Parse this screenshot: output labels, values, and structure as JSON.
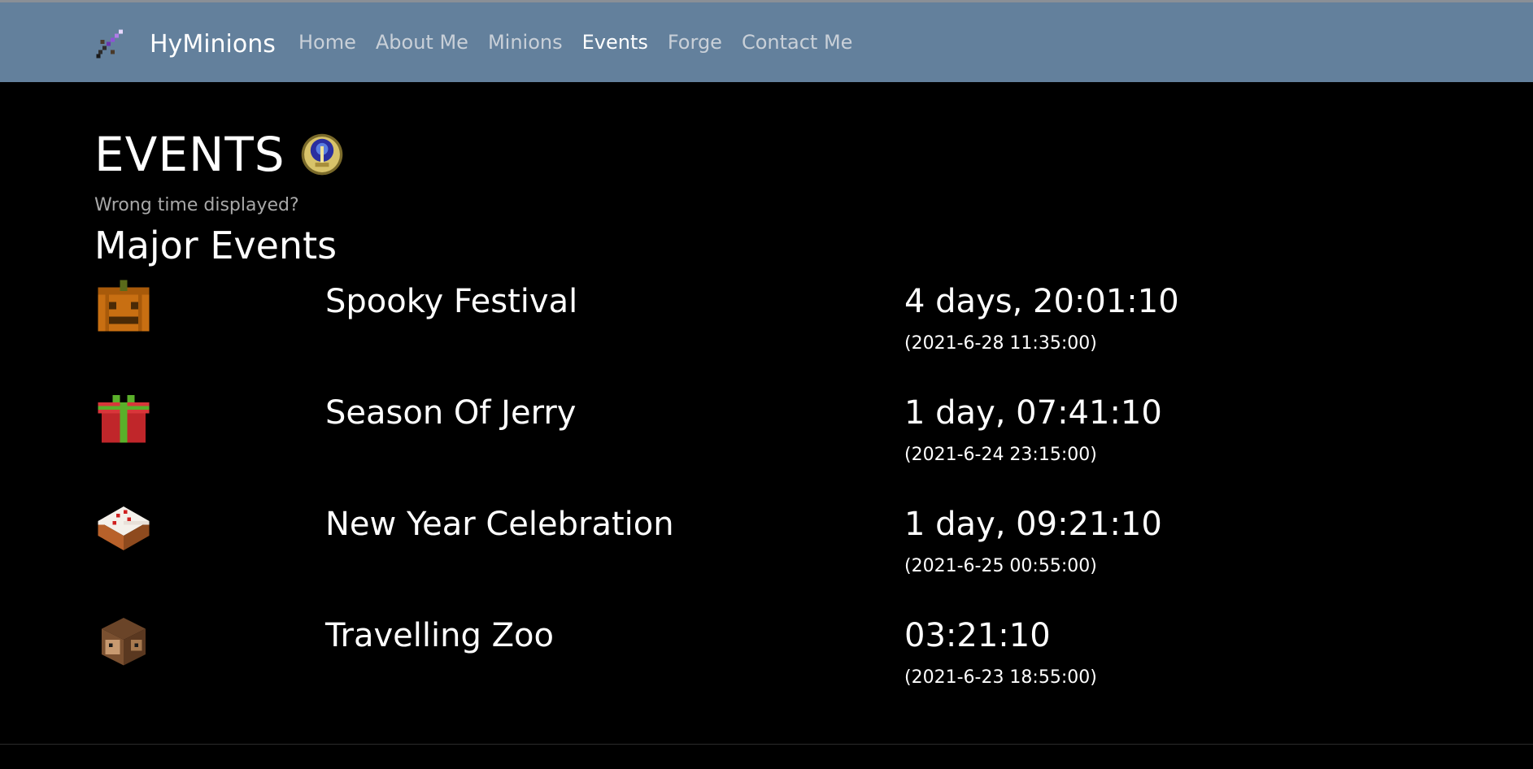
{
  "navbar": {
    "brand": "HyMinions",
    "brand_icon": "purple-sword-icon",
    "background": "#63809c",
    "links": [
      {
        "label": "Home",
        "active": false
      },
      {
        "label": "About Me",
        "active": false
      },
      {
        "label": "Minions",
        "active": false
      },
      {
        "label": "Events",
        "active": true
      },
      {
        "label": "Forge",
        "active": false
      },
      {
        "label": "Contact Me",
        "active": false
      }
    ]
  },
  "page": {
    "title": "EVENTS",
    "title_icon": "compass-clock-icon",
    "subtitle_link": "Wrong time displayed?",
    "section_title": "Major Events"
  },
  "events": [
    {
      "name": "Spooky Festival",
      "countdown": "4 days, 20:01:10",
      "date": "(2021-6-28 11:35:00)",
      "icon": "pumpkin-icon"
    },
    {
      "name": "Season Of Jerry",
      "countdown": "1 day, 07:41:10",
      "date": "(2021-6-24 23:15:00)",
      "icon": "gift-icon"
    },
    {
      "name": "New Year Celebration",
      "countdown": "1 day, 09:21:10",
      "date": "(2021-6-25 00:55:00)",
      "icon": "cake-icon"
    },
    {
      "name": "Travelling Zoo",
      "countdown": "03:21:10",
      "date": "(2021-6-23 18:55:00)",
      "icon": "monkey-head-icon"
    }
  ]
}
